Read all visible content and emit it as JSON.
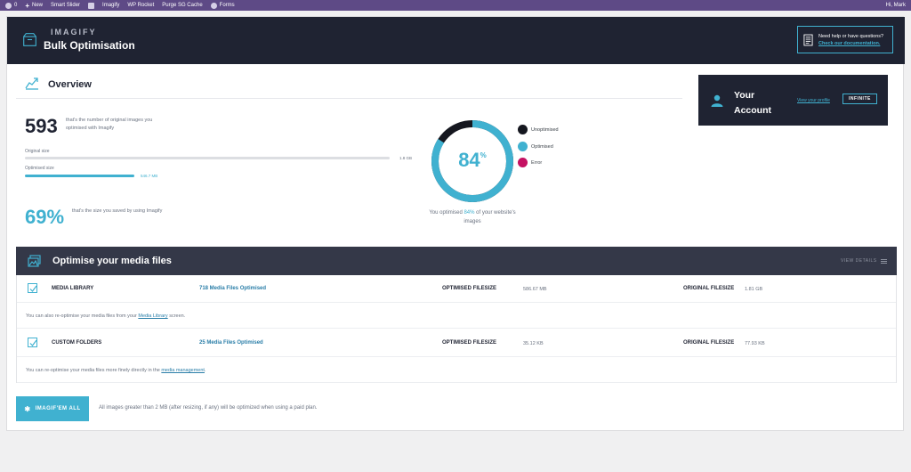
{
  "adminbar": {
    "comments_count": "0",
    "new_label": "New",
    "items": [
      "Smart Slider",
      "Imagify",
      "WP Rocket",
      "Purge SG Cache",
      "Forms"
    ],
    "greeting": "Hi, Mark"
  },
  "header": {
    "brand": "IMAGIFY",
    "title": "Bulk Optimisation",
    "help_question": "Need help or have questions?",
    "help_link": "Check our documentation."
  },
  "overview": {
    "title": "Overview",
    "image_count": "593",
    "image_count_desc": "that's the number of original images you optimised with Imagify",
    "original_size_label": "Original size",
    "original_size_value": "1.8 GB",
    "original_fraction": 1.0,
    "optimised_size_label": "Optimised size",
    "optimised_size_value": "546.7 MB",
    "optimised_fraction": 0.3,
    "saved_percent": "69%",
    "saved_desc": "that's the size you saved by using Imagify",
    "donut_value": "84",
    "donut_unit": "%",
    "donut_fraction": 0.84,
    "caption_before": "You optimised ",
    "caption_pct": "84%",
    "caption_after": " of your website's images",
    "legend": [
      {
        "label": "Unoptimised",
        "color": "#15171f"
      },
      {
        "label": "Optimised",
        "color": "#40b1d0"
      },
      {
        "label": "Error",
        "color": "#c51162"
      }
    ]
  },
  "account": {
    "title": "Your Account",
    "profile_link": "View your profile",
    "plan": "INFINITE"
  },
  "media": {
    "title": "Optimise your media files",
    "view_details": "VIEW DETAILS",
    "optimised_filesize_label": "OPTIMISED FILESIZE",
    "original_filesize_label": "ORIGINAL FILESIZE",
    "rows": [
      {
        "name": "MEDIA LIBRARY",
        "count": "718 Media Files Optimised",
        "optimised_size": "586.67 MB",
        "original_size": "1.81 GB",
        "info_before": "You can also re-optimise your media files from your ",
        "info_link": "Media Library",
        "info_after": " screen."
      },
      {
        "name": "CUSTOM FOLDERS",
        "count": "25 Media Files Optimised",
        "optimised_size": "35.12 KB",
        "original_size": "77.93 KB",
        "info_before": "You can re-optimise your media files more finely directly in the ",
        "info_link": "media management",
        "info_after": "."
      }
    ]
  },
  "cta": {
    "button_label": "IMAGIF'EM ALL",
    "note": "All images greater than 2 MB (after resizing, if any) will be optimized when using a paid plan."
  },
  "colors": {
    "accent": "#40b1d0",
    "dark": "#1f2332",
    "error": "#c51162"
  }
}
